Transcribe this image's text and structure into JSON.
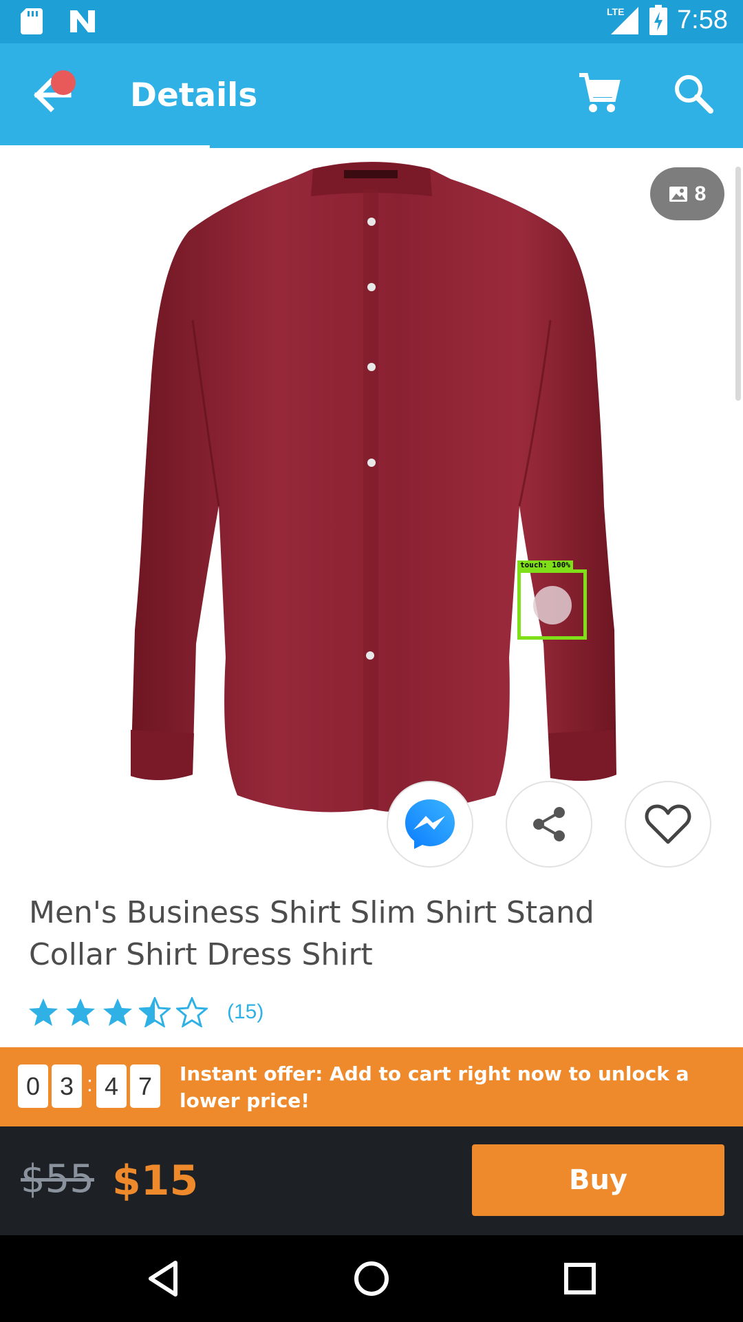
{
  "status_bar": {
    "time": "7:58",
    "network": "LTE",
    "icons": [
      "sd-card-icon",
      "n-app-icon",
      "lte-signal-icon",
      "battery-charging-icon"
    ]
  },
  "app_bar": {
    "title": "Details",
    "back_icon": "arrow-left-icon",
    "cart_icon": "shopping-cart-icon",
    "search_icon": "search-icon"
  },
  "gallery": {
    "image_count": "8",
    "image_icon": "image-icon",
    "shirt_color": "#8e2230"
  },
  "touch_overlay": {
    "label": "touch: 100%"
  },
  "actions": {
    "messenger_icon": "messenger-icon",
    "share_icon": "share-icon",
    "wishlist_icon": "heart-icon"
  },
  "product": {
    "title": "Men's Business Shirt Slim Shirt Stand Collar Shirt Dress Shirt",
    "rating": 3.5,
    "rating_count": "(15)"
  },
  "offer": {
    "timer": [
      "0",
      "3",
      "4",
      "7"
    ],
    "separator": ":",
    "text": "Instant offer: Add to cart right now to unlock a lower price!"
  },
  "purchase": {
    "old_price": "$55",
    "new_price": "$15",
    "buy_label": "Buy"
  },
  "colors": {
    "primary_blue": "#2fb1e6",
    "accent_orange": "#ee8a2b",
    "dark_bar": "#1d2024"
  },
  "nav_bar": {
    "icons": [
      "back-triangle-icon",
      "home-circle-icon",
      "recents-square-icon"
    ]
  }
}
